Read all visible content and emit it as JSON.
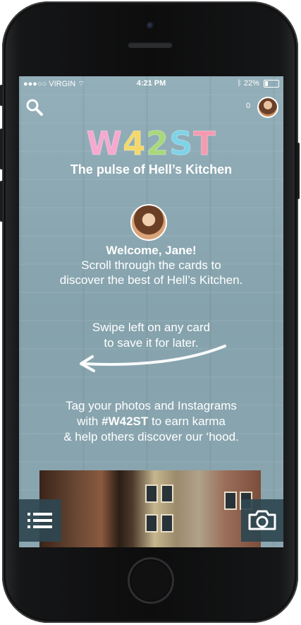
{
  "status_bar": {
    "carrier": "●●●○○ VIRGIN",
    "time": "4:21 PM",
    "battery_pct": "22%",
    "battery_level": 0.22
  },
  "header": {
    "karma_count": "0",
    "search_icon": "search-icon",
    "profile_icon": "avatar"
  },
  "logo": {
    "letters": [
      {
        "char": "W",
        "color": "#f7a8cf"
      },
      {
        "char": "4",
        "color": "#f4d96a"
      },
      {
        "char": "2",
        "color": "#a9d87a"
      },
      {
        "char": "S",
        "color": "#7fd3e8"
      },
      {
        "char": "T",
        "color": "#f79ab0"
      }
    ],
    "tagline": "The pulse of Hell’s Kitchen"
  },
  "welcome": {
    "greeting": "Welcome, Jane!",
    "line1": "Scroll through the cards to",
    "line2": "discover the best of Hell’s Kitchen."
  },
  "swipe_hint": {
    "line1": "Swipe left on any card",
    "line2": "to save it for later."
  },
  "tag_hint": {
    "line1": "Tag your photos and Instagrams",
    "line2_prefix": "with ",
    "hashtag": "#W42ST",
    "line2_suffix": " to earn karma",
    "line3": "& help others discover our ‘hood."
  },
  "footer": {
    "menu_icon": "list-icon",
    "camera_icon": "camera-icon"
  },
  "colors": {
    "screen_bg": "#8eaab4",
    "button_bg": "#2e4650"
  }
}
